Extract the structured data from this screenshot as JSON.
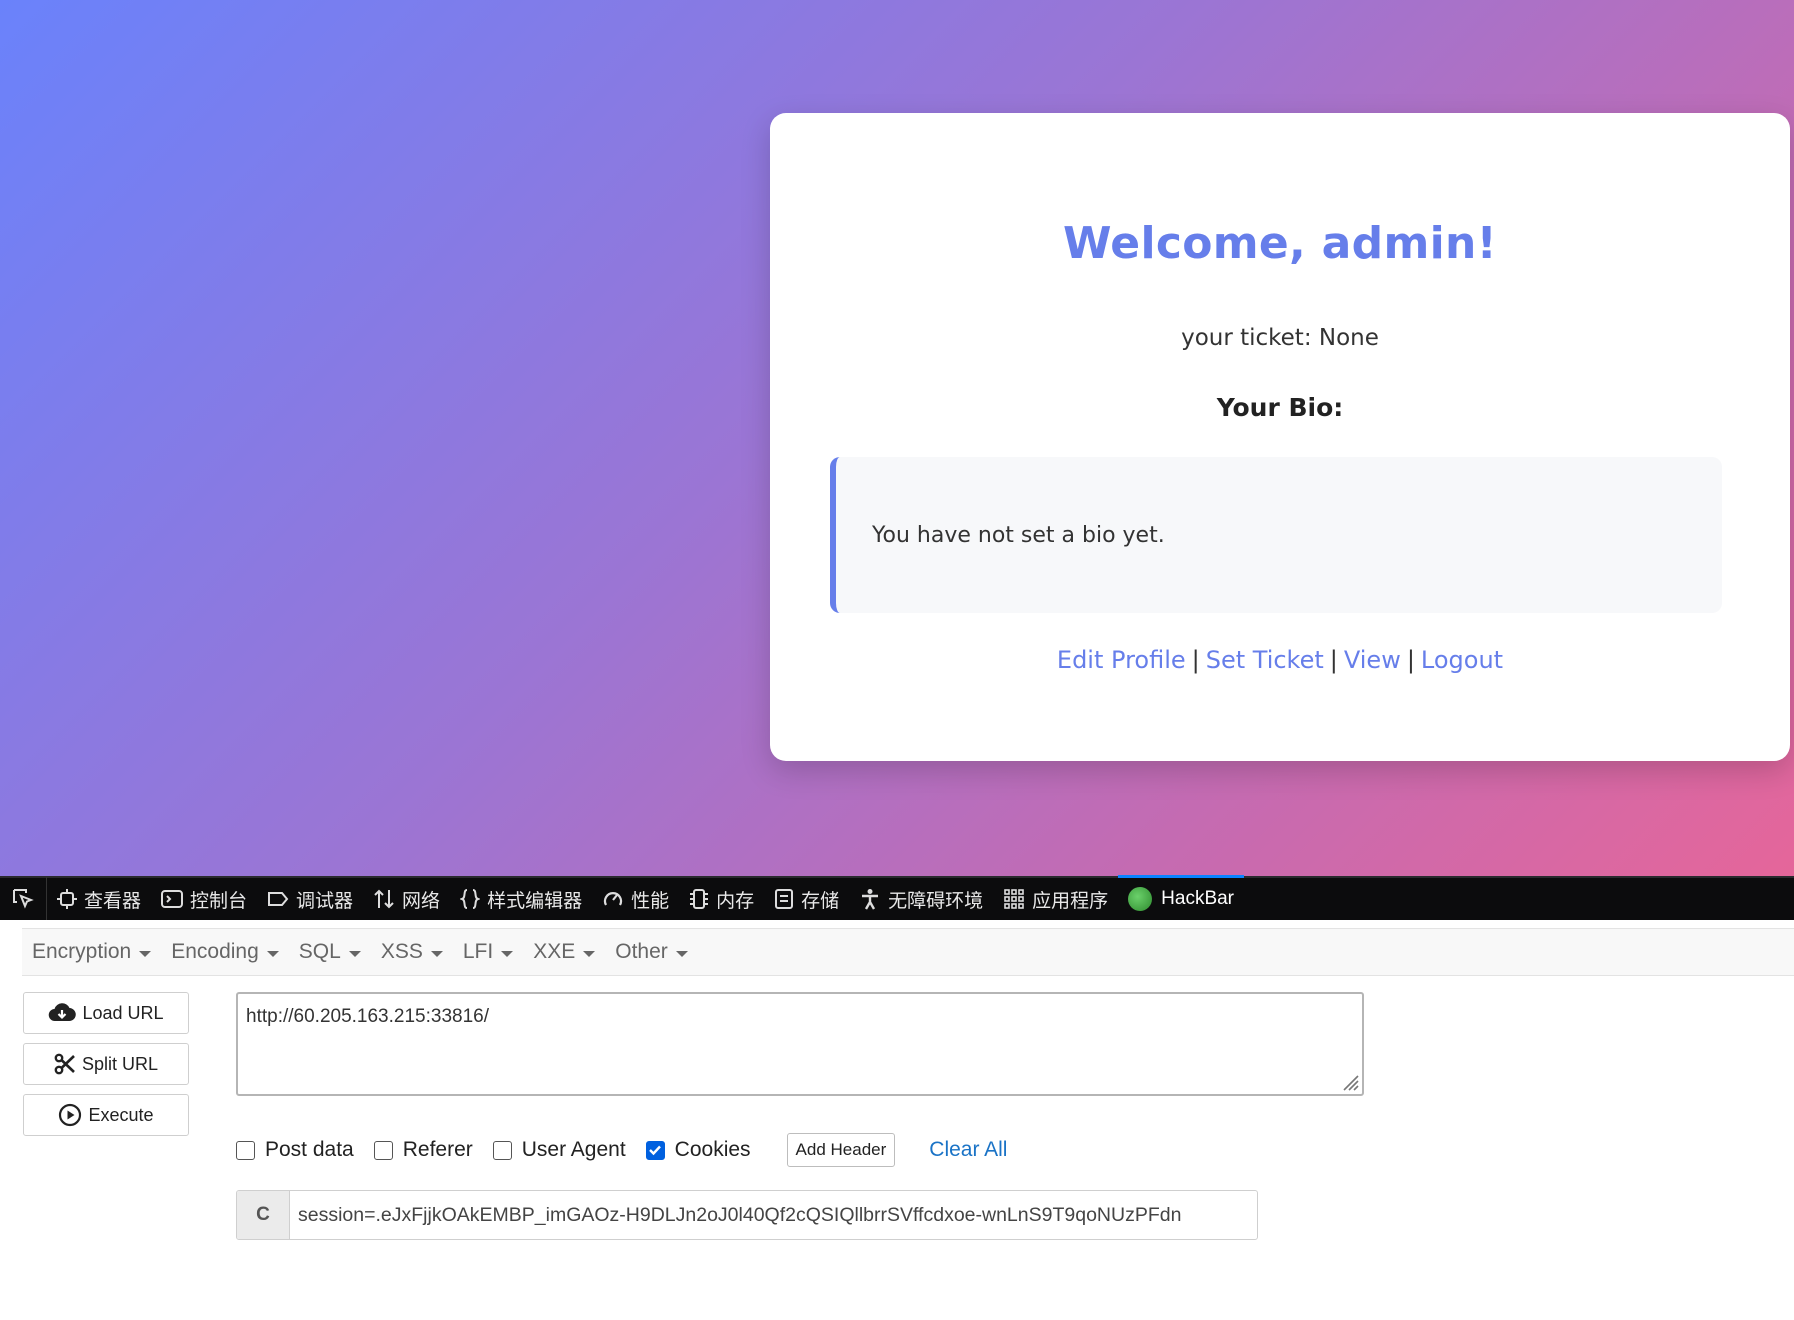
{
  "page": {
    "title": "Welcome, admin!",
    "ticket_text": "your ticket: None",
    "bio_heading": "Your Bio:",
    "bio_text": "You have not set a bio yet.",
    "links": [
      "Edit Profile",
      "Set Ticket",
      "View",
      "Logout"
    ],
    "separator": "|",
    "colors": {
      "accent": "#667eea",
      "gradient_start": "#6a82fb",
      "gradient_end": "#e5669a"
    }
  },
  "devtools": {
    "tabs": [
      {
        "label": "查看器",
        "icon": "inspector-icon"
      },
      {
        "label": "控制台",
        "icon": "console-icon"
      },
      {
        "label": "调试器",
        "icon": "debugger-icon"
      },
      {
        "label": "网络",
        "icon": "network-icon"
      },
      {
        "label": "样式编辑器",
        "icon": "style-editor-icon"
      },
      {
        "label": "性能",
        "icon": "performance-icon"
      },
      {
        "label": "内存",
        "icon": "memory-icon"
      },
      {
        "label": "存储",
        "icon": "storage-icon"
      },
      {
        "label": "无障碍环境",
        "icon": "accessibility-icon"
      },
      {
        "label": "应用程序",
        "icon": "application-icon"
      },
      {
        "label": "HackBar",
        "icon": "hackbar-logo-icon",
        "active": true
      }
    ]
  },
  "hackbar": {
    "menus": [
      "Encryption",
      "Encoding",
      "SQL",
      "XSS",
      "LFI",
      "XXE",
      "Other"
    ],
    "buttons": {
      "load_url": "Load URL",
      "split_url": "Split URL",
      "execute": "Execute"
    },
    "url": "http://60.205.163.215:33816/",
    "options": {
      "post_data": {
        "label": "Post data",
        "checked": false
      },
      "referer": {
        "label": "Referer",
        "checked": false
      },
      "user_agent": {
        "label": "User Agent",
        "checked": false
      },
      "cookies": {
        "label": "Cookies",
        "checked": true
      }
    },
    "add_header": "Add Header",
    "clear_all": "Clear All",
    "cookie_label": "C",
    "cookie_value": "session=.eJxFjjkOAkEMBP_imGAOz-H9DLJn2oJ0l40Qf2cQSIQllbrrSVffcdxoe-wnLnS9T9qoNUzPFdn"
  }
}
